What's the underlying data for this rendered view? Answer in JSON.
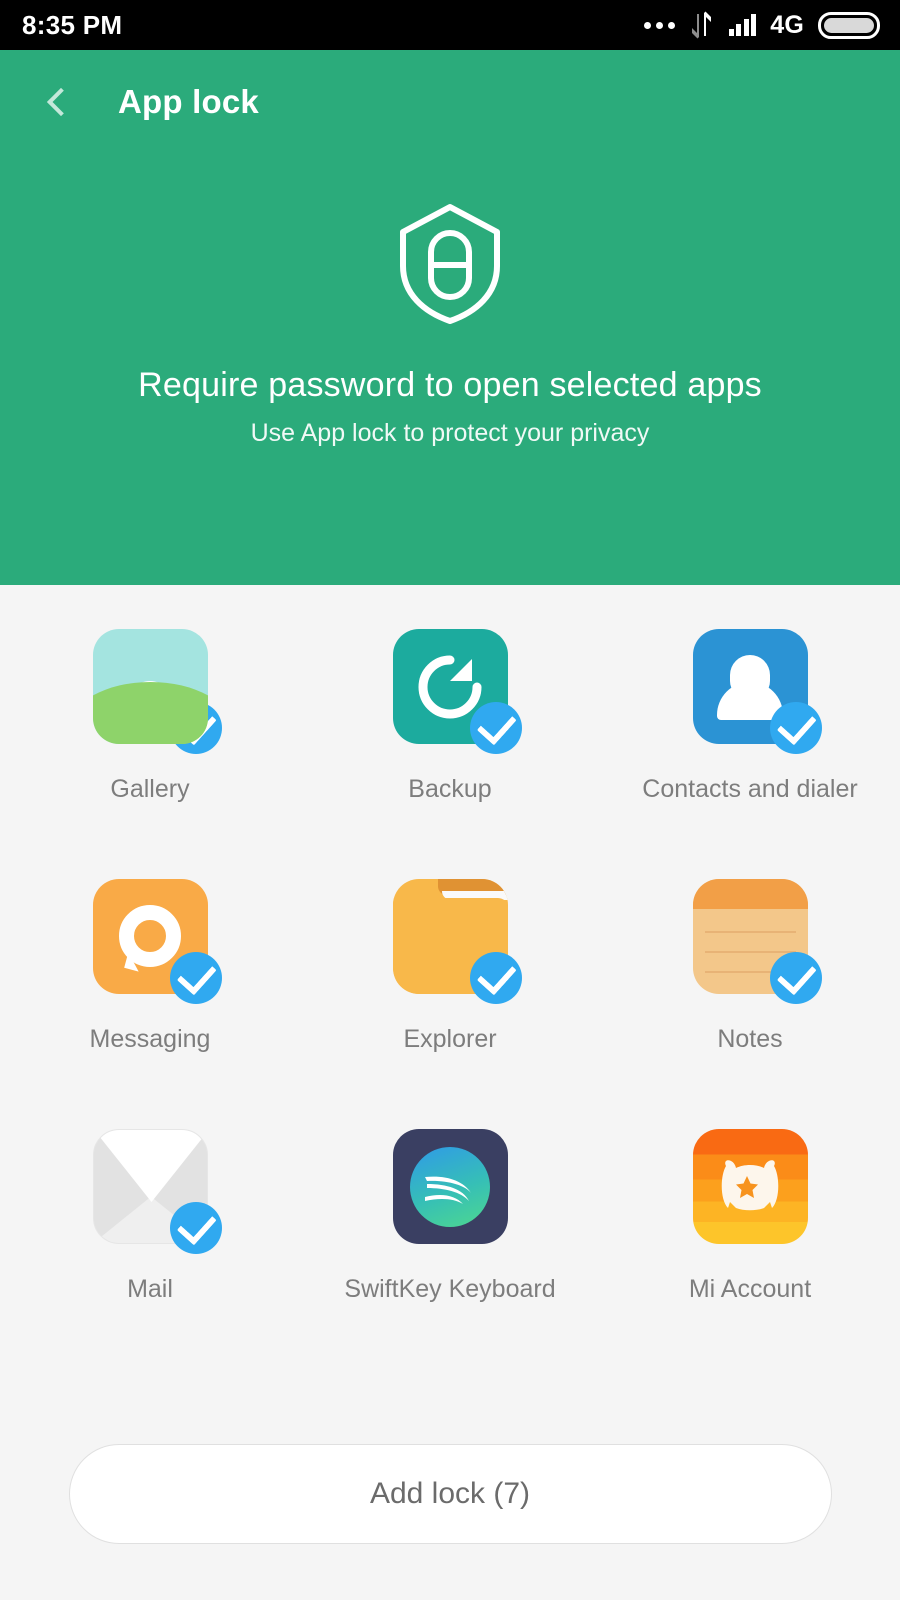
{
  "status_bar": {
    "time": "8:35 PM",
    "network_label": "4G",
    "icons": [
      "more-dots-icon",
      "data-transfer-icon",
      "signal-bars-icon",
      "battery-icon"
    ]
  },
  "header": {
    "back_icon": "back-chevron-icon",
    "title": "App lock",
    "shield_icon": "shield-lock-icon",
    "hero_title": "Require password to open selected apps",
    "hero_subtitle": "Use App lock to protect your privacy",
    "background_color": "#2bab7b"
  },
  "apps": [
    {
      "label": "Gallery",
      "icon": "gallery-icon",
      "checked": true
    },
    {
      "label": "Backup",
      "icon": "backup-icon",
      "checked": true
    },
    {
      "label": "Contacts and dialer",
      "icon": "contacts-icon",
      "checked": true
    },
    {
      "label": "Messaging",
      "icon": "messaging-icon",
      "checked": true
    },
    {
      "label": "Explorer",
      "icon": "explorer-icon",
      "checked": true
    },
    {
      "label": "Notes",
      "icon": "notes-icon",
      "checked": true
    },
    {
      "label": "Mail",
      "icon": "mail-icon",
      "checked": true
    },
    {
      "label": "SwiftKey Keyboard",
      "icon": "swiftkey-icon",
      "checked": false
    },
    {
      "label": "Mi Account",
      "icon": "mi-account-icon",
      "checked": false
    }
  ],
  "footer": {
    "add_lock_label": "Add lock (7)",
    "selected_count": 7
  },
  "colors": {
    "accent_green": "#2bab7b",
    "check_blue": "#30a9f0",
    "body_background": "#f5f5f5",
    "label_text": "#7d7d7d"
  }
}
